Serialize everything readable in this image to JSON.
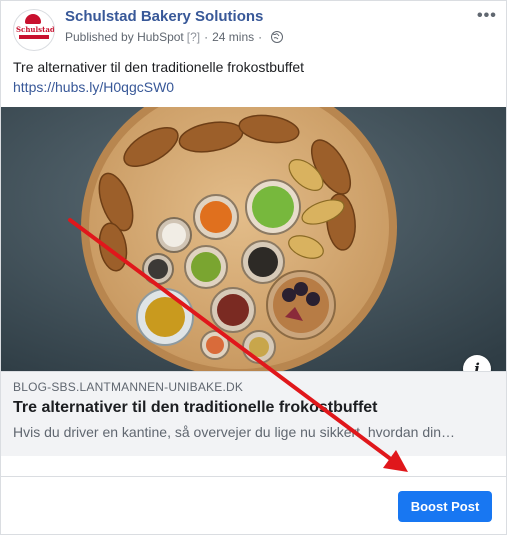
{
  "post": {
    "page_name": "Schulstad Bakery Solutions",
    "published_by_label": "Published by",
    "publisher": "HubSpot",
    "publisher_help": "[?]",
    "separator": "·",
    "time": "24 mins",
    "privacy_icon": "globe-icon",
    "avatar_text": "Schulstad",
    "more_options": "•••",
    "text": "Tre alternativer til den traditionelle frokostbuffet",
    "link": "https://hubs.ly/H0qgcSW0"
  },
  "link_preview": {
    "domain": "BLOG-SBS.LANTMANNEN-UNIBAKE.DK",
    "title": "Tre alternativer til den traditionelle frokostbuffet",
    "description": "Hvis du driver en kantine, så overvejer du lige nu sikkert, hvordan din…",
    "info_label": "i"
  },
  "actions": {
    "boost_label": "Boost Post"
  },
  "colors": {
    "accent": "#1877f2",
    "link": "#385898",
    "brand": "#c8102e",
    "annotation_arrow": "#e0171b"
  }
}
